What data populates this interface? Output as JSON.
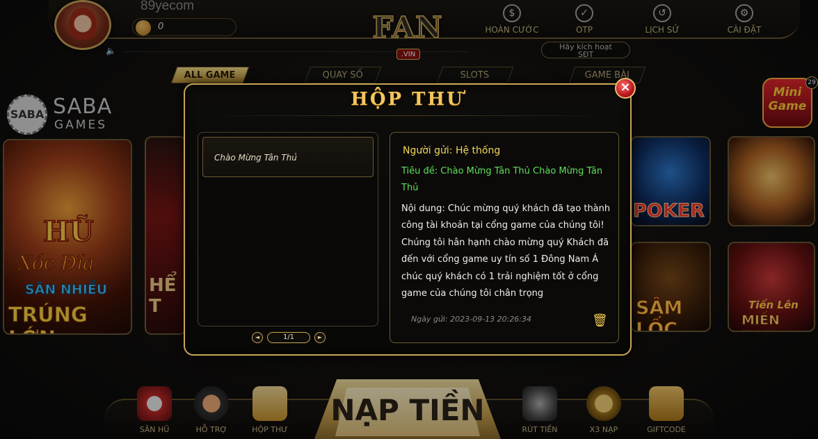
{
  "header": {
    "username": "89yecom",
    "balance": "0",
    "logo_text": "FAN",
    "logo_sub": ".VIN",
    "nav": [
      {
        "label": "HOÀN CƯỚC",
        "icon": "dollar-circle-icon",
        "glyph": "$"
      },
      {
        "label": "OTP",
        "icon": "shield-check-icon",
        "glyph": "✓"
      },
      {
        "label": "LỊCH SỬ",
        "icon": "history-icon",
        "glyph": "↺"
      },
      {
        "label": "CÀI ĐẶT",
        "icon": "gear-icon",
        "glyph": "⚙"
      }
    ],
    "activate_line1": "Hãy kích hoạt",
    "activate_line2": "SĐT"
  },
  "categories": [
    "ALL GAME",
    "QUAY SỐ",
    "SLOTS",
    "GAME BÀI"
  ],
  "provider": {
    "name": "SABA",
    "sub": "GAMES",
    "badge": "SABA"
  },
  "minigame": {
    "line1": "Mini",
    "line2": "Game",
    "badge": "29"
  },
  "tiles": {
    "hu_a": "HŨ",
    "hu_b": "Xóc Đĩa",
    "hu_c": "SĂN NHIỀU",
    "hu_d": "TRÚNG LỚN",
    "sport": "HỂ T",
    "poker": "POKER",
    "samloc": "SÂM LỐC",
    "tienlen_a": "Tiến Lên",
    "tienlen_b": "MIỀN NAM"
  },
  "bottom_nav": {
    "san_hu": "SĂN HŨ",
    "ho_tro": "HỖ TRỢ",
    "hop_thu": "HỘP THƯ",
    "nap_tien": "NẠP TIỀN",
    "rut_tien": "RÚT TIỀN",
    "x3_nap": "X3 NẠP",
    "giftcode": "GIFTCODE"
  },
  "mailbox": {
    "title": "HỘP THƯ",
    "close": "×",
    "items": [
      {
        "label": "Chào Mừng Tân Thủ"
      }
    ],
    "pager": {
      "current": "1/1",
      "prev": "◄",
      "next": "►"
    },
    "detail": {
      "sender": "Người gửi: Hệ thống",
      "subject": "Tiêu đề: Chào Mừng Tân Thủ  Chào Mừng Tân Thủ",
      "content": "Nội dung: Chúc mừng quý khách đã tạo thành công tài khoản tại cổng game của chúng tôi! Chúng tôi hân hạnh chào mừng quý Khách đã đến với cổng game uy tín số 1 Đông Nam Á chúc quý khách có 1 trải nghiệm tốt ở cổng game của chúng tôi chân trọng",
      "date": "Ngày gửi: 2023-09-13 20:26:34"
    }
  },
  "colors": {
    "accent_gold": "#c9a556",
    "sender": "#f0d75a",
    "subject": "#5fe05a",
    "close_red": "#b3121a"
  }
}
